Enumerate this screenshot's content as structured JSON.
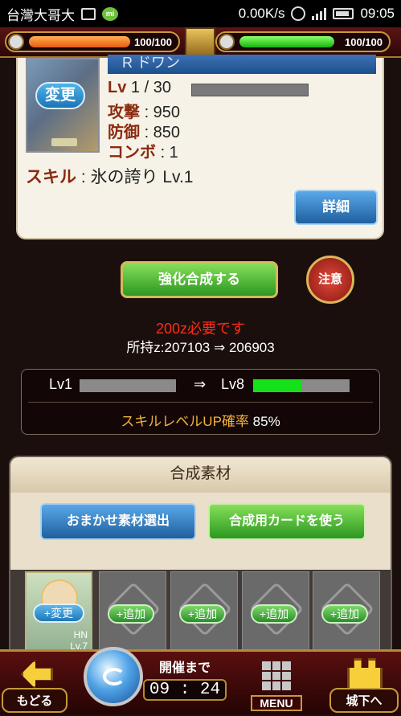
{
  "status_bar": {
    "carrier": "台灣大哥大",
    "net_speed": "0.00K/s",
    "network": "3G",
    "time": "09:05"
  },
  "hud": {
    "stamina": "100/100",
    "stamina_fraction": 1.0,
    "bp": "100/100",
    "bp_fraction": 1.0
  },
  "card": {
    "name": "R ドワン",
    "change_label": "変更",
    "lv_label": "Lv",
    "lv_value": "1 / 30",
    "attack_label": "攻撃",
    "attack_value": ": 950",
    "defense_label": "防御",
    "defense_value": ": 850",
    "combo_label": "コンボ",
    "combo_value": ": 1",
    "skill_label": "スキル",
    "skill_value": ": 氷の誇り Lv.1",
    "detail_label": "詳細"
  },
  "synth": {
    "button_label": "強化合成する",
    "caution_label": "注意",
    "cost": "200z必要です",
    "owned": "所持z:207103 ⇒ 206903"
  },
  "level_panel": {
    "from": "Lv1",
    "arrow": "⇒",
    "to": "Lv8",
    "to_progress": 0.5,
    "skillup_label": "スキルレベルUP確率",
    "skillup_value": "85%"
  },
  "materials": {
    "title": "合成素材",
    "auto_select_label": "おまかせ素材選出",
    "use_card_label": "合成用カードを使う",
    "card_change_label": "+変更",
    "card_name": "HN",
    "card_level": "Lv.7",
    "add_label": "+追加"
  },
  "bottom_nav": {
    "back_label": "もどる",
    "event_label": "開催まで",
    "event_time": "09 : 24",
    "menu_label": "MENU",
    "castle_label": "城下へ"
  },
  "colors": {
    "stamina": "#e95b12",
    "bp": "#16b40f",
    "cost_text": "#ff2b1a",
    "skillup_text": "#f2b13a",
    "level_bar": "#16e01a"
  }
}
